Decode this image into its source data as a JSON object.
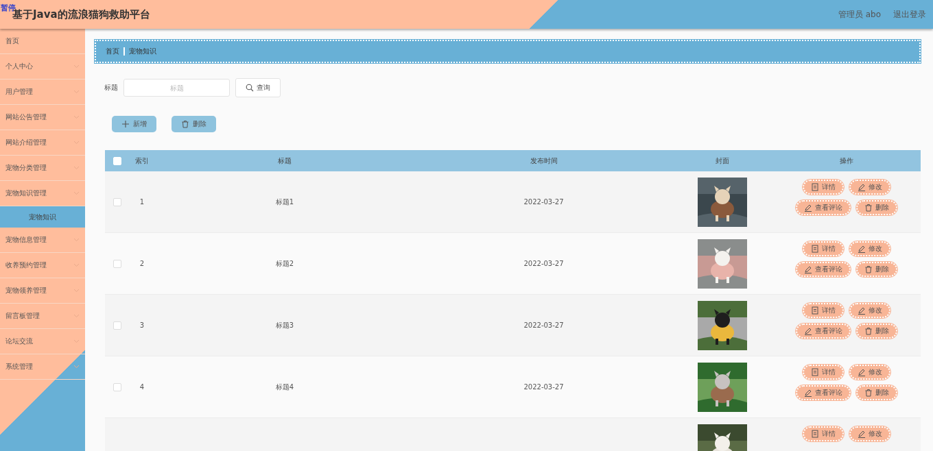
{
  "header": {
    "title": "基于Java的流浪猫狗救助平台",
    "pause_badge": "暂停",
    "user": "管理员 abo",
    "logout": "退出登录"
  },
  "sidebar": {
    "items": [
      {
        "label": "首页",
        "kind": "link",
        "selected": false
      },
      {
        "label": "个人中心",
        "kind": "menu",
        "selected": false
      },
      {
        "label": "用户管理",
        "kind": "menu",
        "selected": false
      },
      {
        "label": "网站公告管理",
        "kind": "menu",
        "selected": false
      },
      {
        "label": "网站介绍管理",
        "kind": "menu",
        "selected": false
      },
      {
        "label": "宠物分类管理",
        "kind": "menu",
        "selected": false
      },
      {
        "label": "宠物知识管理",
        "kind": "menu",
        "selected": false,
        "children": [
          {
            "label": "宠物知识",
            "selected": true
          }
        ]
      },
      {
        "label": "宠物信息管理",
        "kind": "menu",
        "selected": false
      },
      {
        "label": "收养预约管理",
        "kind": "menu",
        "selected": false
      },
      {
        "label": "宠物领养管理",
        "kind": "menu",
        "selected": false
      },
      {
        "label": "留言板管理",
        "kind": "menu",
        "selected": false
      },
      {
        "label": "论坛交流",
        "kind": "menu",
        "selected": false
      },
      {
        "label": "系统管理",
        "kind": "menu",
        "selected": false
      }
    ]
  },
  "breadcrumb": [
    "首页",
    "宠物知识"
  ],
  "search": {
    "label": "标题",
    "placeholder": "标题",
    "button": "查询"
  },
  "actions": [
    {
      "kind": "add",
      "label": "新增"
    },
    {
      "kind": "delete",
      "label": "删除"
    }
  ],
  "table": {
    "select_all": {
      "checked": false
    },
    "columns": [
      "索引",
      "标题",
      "发布时间",
      "封面",
      "操作"
    ],
    "rows": [
      {
        "checked": false,
        "index": "1",
        "title": "标题1",
        "date": "2022-03-27",
        "cover": {
          "kind": "picture"
        },
        "buttons": [
          {
            "kind": "detail",
            "label": "详情"
          },
          {
            "kind": "edit",
            "label": "修改"
          },
          {
            "kind": "comment",
            "label": "查看评论"
          },
          {
            "kind": "delete",
            "label": "删除"
          }
        ]
      },
      {
        "checked": false,
        "index": "2",
        "title": "标题2",
        "date": "2022-03-27",
        "cover": {
          "kind": "picture"
        },
        "buttons": [
          {
            "kind": "detail",
            "label": "详情"
          },
          {
            "kind": "edit",
            "label": "修改"
          },
          {
            "kind": "comment",
            "label": "查看评论"
          },
          {
            "kind": "delete",
            "label": "删除"
          }
        ]
      },
      {
        "checked": false,
        "index": "3",
        "title": "标题3",
        "date": "2022-03-27",
        "cover": {
          "kind": "picture"
        },
        "buttons": [
          {
            "kind": "detail",
            "label": "详情"
          },
          {
            "kind": "edit",
            "label": "修改"
          },
          {
            "kind": "comment",
            "label": "查看评论"
          },
          {
            "kind": "delete",
            "label": "删除"
          }
        ]
      },
      {
        "checked": false,
        "index": "4",
        "title": "标题4",
        "date": "2022-03-27",
        "cover": {
          "kind": "picture"
        },
        "buttons": [
          {
            "kind": "detail",
            "label": "详情"
          },
          {
            "kind": "edit",
            "label": "修改"
          },
          {
            "kind": "comment",
            "label": "查看评论"
          },
          {
            "kind": "delete",
            "label": "删除"
          }
        ]
      },
      {
        "cover": {
          "kind": "picture"
        },
        "buttons": [
          {
            "kind": "detail",
            "label": "详情"
          },
          {
            "kind": "edit",
            "label": "修改"
          }
        ]
      }
    ]
  }
}
